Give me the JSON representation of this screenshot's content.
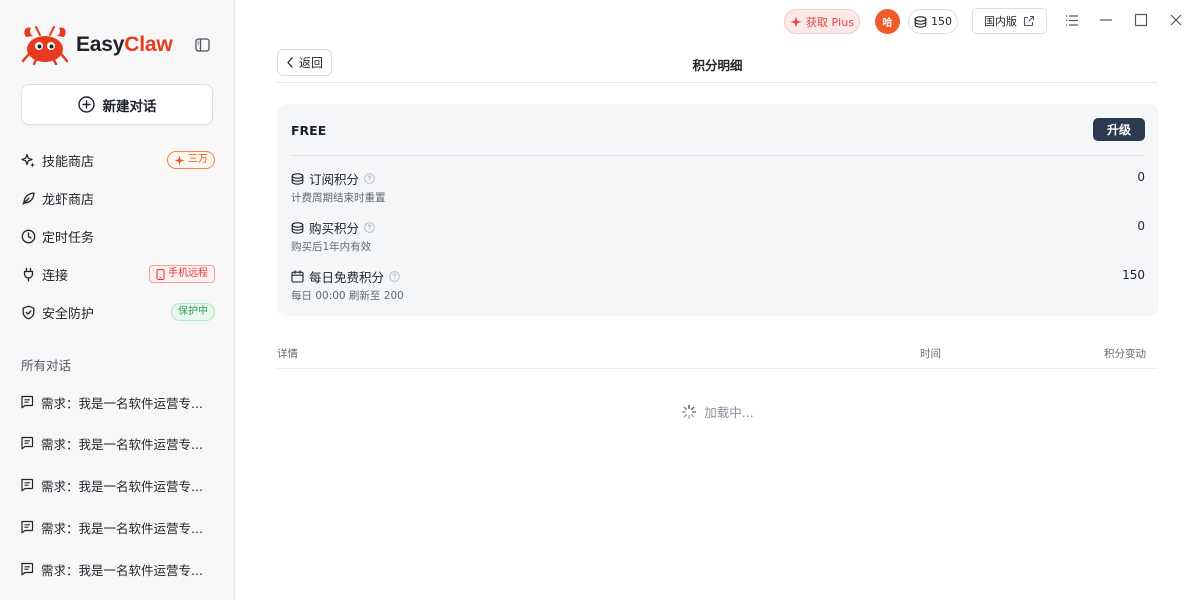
{
  "brand": {
    "name_easy": "Easy",
    "name_claw": "Claw"
  },
  "sidebar": {
    "new_chat_label": "新建对话",
    "nav": [
      {
        "label": "技能商店",
        "icon": "sparkle-icon",
        "badge": "三万"
      },
      {
        "label": "龙虾商店",
        "icon": "leaf-icon"
      },
      {
        "label": "定时任务",
        "icon": "clock-icon"
      },
      {
        "label": "连接",
        "icon": "plug-icon",
        "badge": "手机远程"
      },
      {
        "label": "安全防护",
        "icon": "shield-check-icon",
        "badge": "保护中"
      }
    ],
    "section_title": "所有对话",
    "conversations": [
      "需求：我是一名软件运营专...",
      "需求：我是一名软件运营专...",
      "需求：我是一名软件运营专...",
      "需求：我是一名软件运营专...",
      "需求：我是一名软件运营专..."
    ]
  },
  "topbar": {
    "plus_label": "获取 Plus",
    "avatar_text": "哈",
    "credits": "150",
    "region_label": "国内版"
  },
  "page": {
    "back_label": "返回",
    "title": "积分明细"
  },
  "card": {
    "plan": "FREE",
    "upgrade_label": "升级",
    "rows": [
      {
        "title": "订阅积分",
        "subtitle": "计费周期结束时重置",
        "value": "0",
        "icon": "coins-icon"
      },
      {
        "title": "购买积分",
        "subtitle": "购买后1年内有效",
        "value": "0",
        "icon": "coins-icon"
      },
      {
        "title": "每日免费积分",
        "subtitle": "每日 00:00 刷新至 200",
        "value": "150",
        "icon": "calendar-icon"
      }
    ]
  },
  "table": {
    "col_detail": "详情",
    "col_time": "时间",
    "col_change": "积分变动",
    "loading_text": "加载中..."
  },
  "colors": {
    "accent_red": "#e83a1f",
    "upgrade_bg": "#2c3a50",
    "avatar_bg": "#ef5a2b"
  }
}
